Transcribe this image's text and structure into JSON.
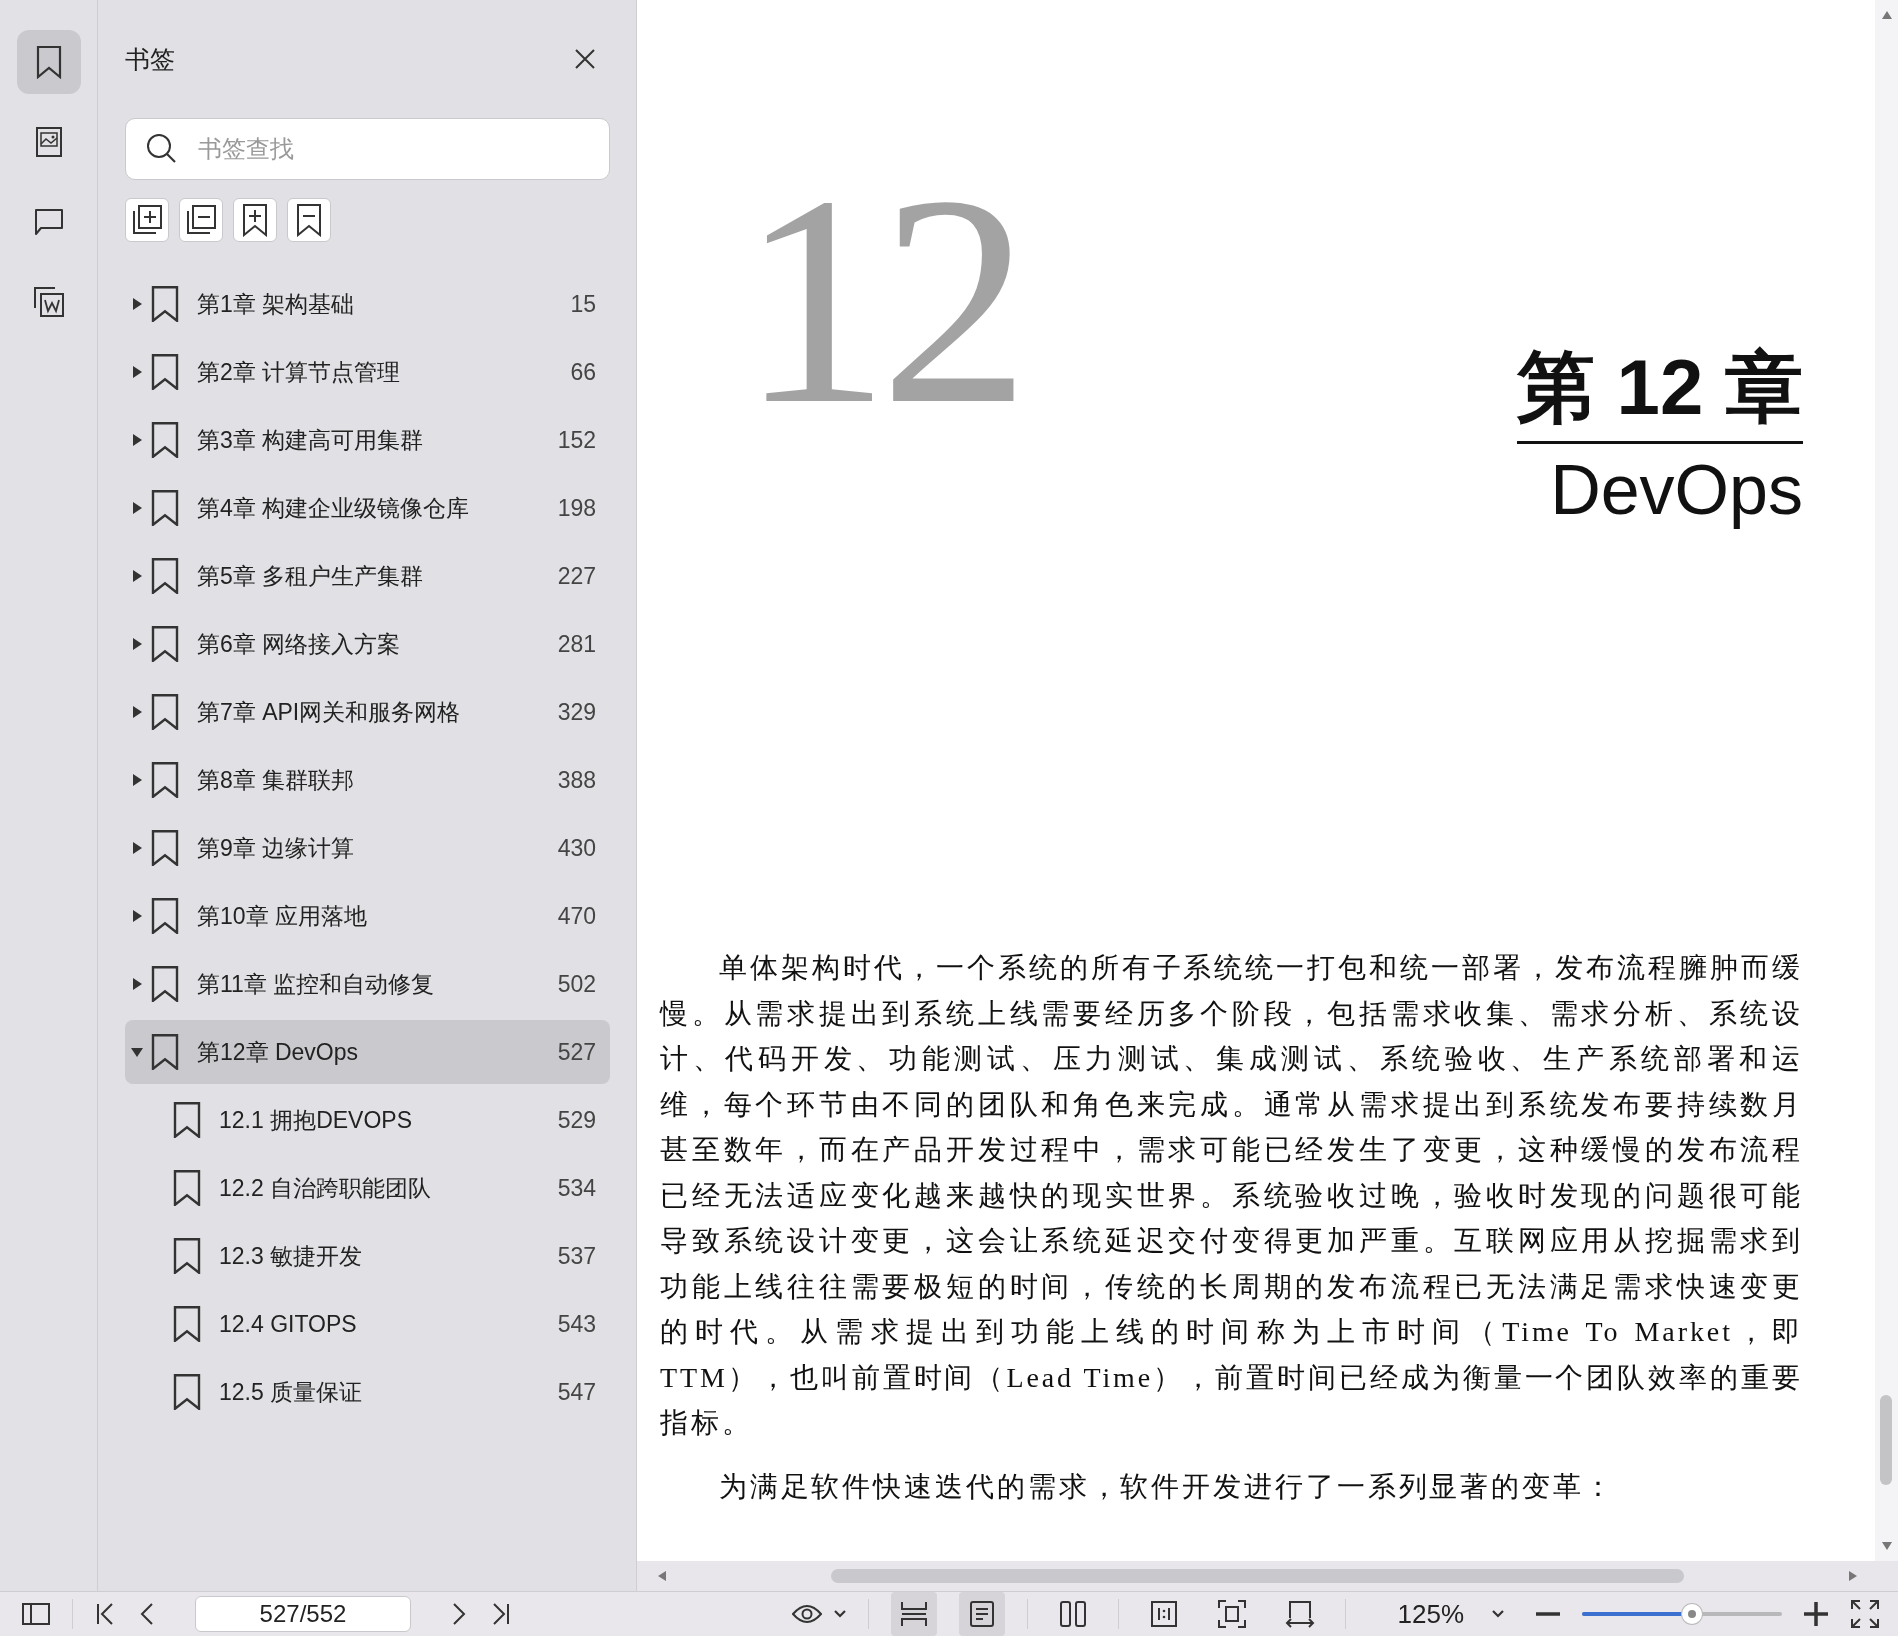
{
  "rail": [
    {
      "kind": "bookmarks",
      "selected": true
    },
    {
      "kind": "thumbnails",
      "selected": false
    },
    {
      "kind": "comments",
      "selected": false
    },
    {
      "kind": "attachments",
      "selected": false
    }
  ],
  "panel": {
    "title": "书签",
    "search": {
      "placeholder": "书签查找"
    }
  },
  "bookmarks": [
    {
      "label": "第1章 架构基础",
      "page": "15",
      "expanded": false,
      "selected": false
    },
    {
      "label": "第2章 计算节点管理",
      "page": "66",
      "expanded": false,
      "selected": false
    },
    {
      "label": "第3章 构建高可用集群",
      "page": "152",
      "expanded": false,
      "selected": false
    },
    {
      "label": "第4章 构建企业级镜像仓库",
      "page": "198",
      "expanded": false,
      "selected": false
    },
    {
      "label": "第5章 多租户生产集群",
      "page": "227",
      "expanded": false,
      "selected": false
    },
    {
      "label": "第6章 网络接入方案",
      "page": "281",
      "expanded": false,
      "selected": false
    },
    {
      "label": "第7章 API网关和服务网格",
      "page": "329",
      "expanded": false,
      "selected": false
    },
    {
      "label": "第8章 集群联邦",
      "page": "388",
      "expanded": false,
      "selected": false
    },
    {
      "label": "第9章 边缘计算",
      "page": "430",
      "expanded": false,
      "selected": false
    },
    {
      "label": "第10章 应用落地",
      "page": "470",
      "expanded": false,
      "selected": false
    },
    {
      "label": "第11章 监控和自动修复",
      "page": "502",
      "expanded": false,
      "selected": false
    },
    {
      "label": "第12章 DevOps",
      "page": "527",
      "expanded": true,
      "selected": true,
      "children": [
        {
          "label": "12.1 拥抱DEVOPS",
          "page": "529",
          "selected": false
        },
        {
          "label": "12.2 自治跨职能团队",
          "page": "534",
          "selected": false
        },
        {
          "label": "12.3 敏捷开发",
          "page": "537",
          "selected": false
        },
        {
          "label": "12.4 GITOPS",
          "page": "543",
          "selected": false
        },
        {
          "label": "12.5 质量保证",
          "page": "547",
          "selected": false
        }
      ]
    }
  ],
  "document": {
    "chapter_number": "12",
    "chapter_label": "第 12 章",
    "chapter_title": "DevOps",
    "paragraphs": [
      "单体架构时代，一个系统的所有子系统统一打包和统一部署，发布流程臃肿而缓慢。从需求提出到系统上线需要经历多个阶段，包括需求收集、需求分析、系统设计、代码开发、功能测试、压力测试、集成测试、系统验收、生产系统部署和运维，每个环节由不同的团队和角色来完成。通常从需求提出到系统发布要持续数月甚至数年，而在产品开发过程中，需求可能已经发生了变更，这种缓慢的发布流程已经无法适应变化越来越快的现实世界。系统验收过晚，验收时发现的问题很可能导致系统设计变更，这会让系统延迟交付变得更加严重。互联网应用从挖掘需求到功能上线往往需要极短的时间，传统的长周期的发布流程已无法满足需求快速变更的时代。从需求提出到功能上线的时间称为上市时间（Time To Market，即 TTM），也叫前置时间（Lead Time），前置时间已经成为衡量一个团队效率的重要指标。",
      "为满足软件快速迭代的需求，软件开发进行了一系列显著的变革："
    ]
  },
  "toolbar": {
    "page_field": "527/552",
    "zoom": "125%",
    "zoom_slider": {
      "level": 0.55
    },
    "view_buttons": [
      {
        "kind": "continuous",
        "selected": true
      },
      {
        "kind": "single",
        "selected": true
      },
      {
        "kind": "two-page",
        "selected": false
      },
      {
        "kind": "actual-size",
        "selected": false
      },
      {
        "kind": "fit-page",
        "selected": false
      },
      {
        "kind": "fit-width",
        "selected": false
      }
    ]
  }
}
